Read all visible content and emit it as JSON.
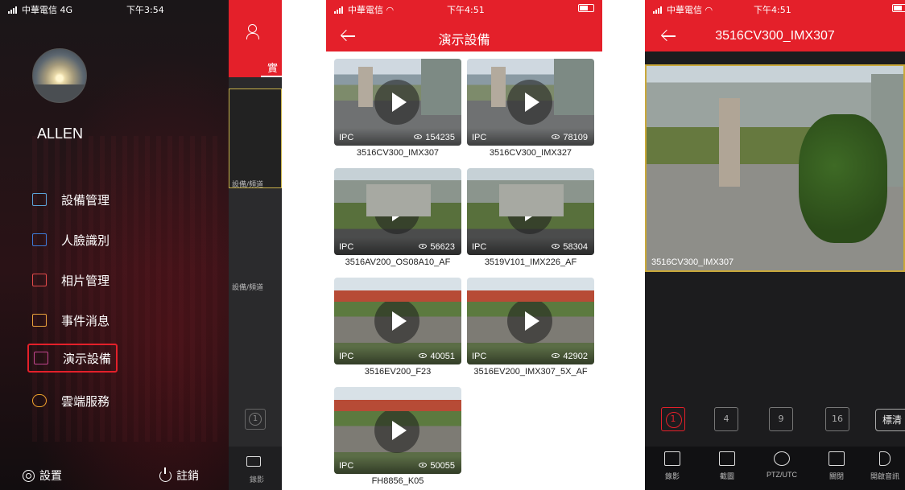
{
  "screen1": {
    "status": {
      "carrier": "中華電信 4G",
      "time": "下午3:54"
    },
    "username": "ALLEN",
    "menu": [
      {
        "label": "設備管理",
        "icon": "camera-icon"
      },
      {
        "label": "人臉識別",
        "icon": "face-scan-icon"
      },
      {
        "label": "相片管理",
        "icon": "photo-icon"
      },
      {
        "label": "事件消息",
        "icon": "inbox-icon"
      },
      {
        "label": "演示設備",
        "icon": "play-screen-icon"
      },
      {
        "label": "雲端服務",
        "icon": "cloud-icon"
      }
    ],
    "active_menu": "演示設備",
    "settings_label": "設置",
    "logout_label": "註銷",
    "peek": {
      "tab": "實",
      "channel_label_1": "設備/頻道",
      "channel_label_2": "設備/頻道",
      "layout_num": "1",
      "record_label": "錄影"
    }
  },
  "screen2": {
    "status": {
      "carrier": "中華電信",
      "time": "下午4:51"
    },
    "title": "演示設備",
    "devices": [
      {
        "name": "3516CV300_IMX307",
        "type": "IPC",
        "views": "154235"
      },
      {
        "name": "3516CV300_IMX327",
        "type": "IPC",
        "views": "78109"
      },
      {
        "name": "3516AV200_OS08A10_AF",
        "type": "IPC",
        "views": "56623"
      },
      {
        "name": "3519V101_IMX226_AF",
        "type": "IPC",
        "views": "58304"
      },
      {
        "name": "3516EV200_F23",
        "type": "IPC",
        "views": "40051"
      },
      {
        "name": "3516EV200_IMX307_5X_AF",
        "type": "IPC",
        "views": "42902"
      },
      {
        "name": "FH8856_K05",
        "type": "IPC",
        "views": "50055"
      }
    ]
  },
  "screen3": {
    "status": {
      "carrier": "中華電信",
      "time": "下午4:51"
    },
    "title": "3516CV300_IMX307",
    "video_caption": "3516CV300_IMX307",
    "layouts": [
      "1",
      "4",
      "9",
      "16"
    ],
    "quality_label": "標清",
    "toolbar": [
      {
        "label": "錄影",
        "icon": "record-icon"
      },
      {
        "label": "截圖",
        "icon": "screenshot-icon"
      },
      {
        "label": "PTZ/UTC",
        "icon": "ptz-icon"
      },
      {
        "label": "關閉",
        "icon": "close-icon"
      },
      {
        "label": "開啟音訊",
        "icon": "speaker-mute-icon"
      }
    ]
  }
}
